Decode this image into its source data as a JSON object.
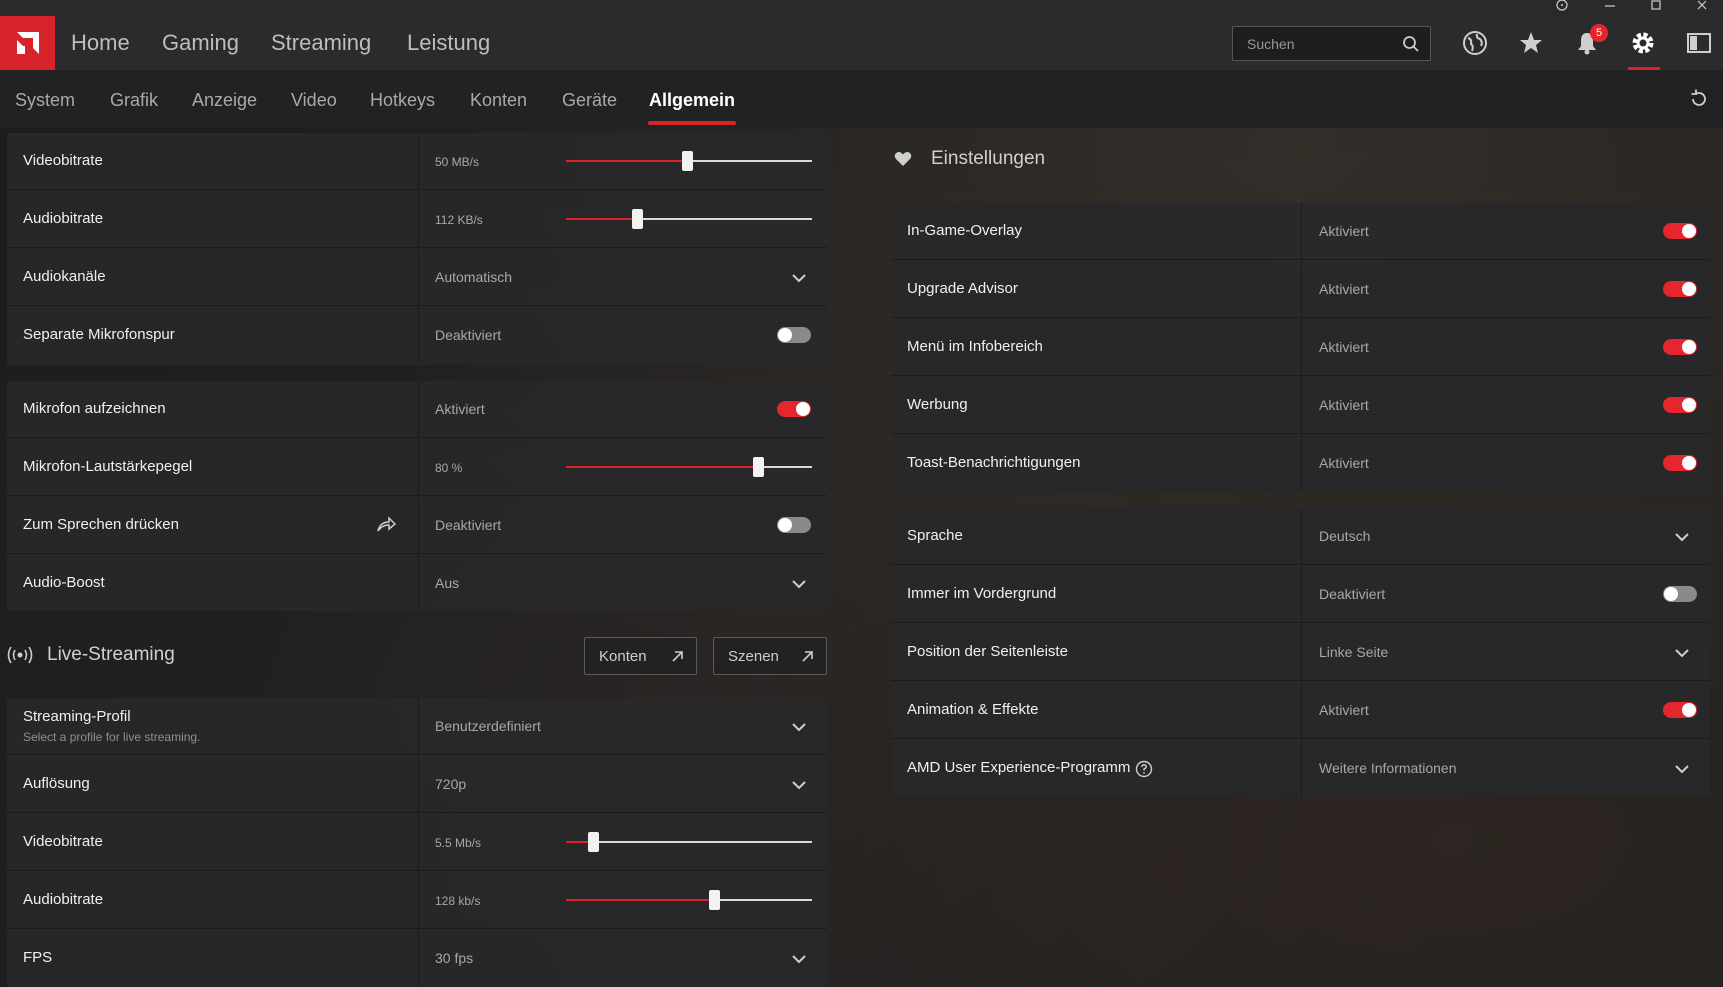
{
  "topnav": {
    "items": [
      "Home",
      "Gaming",
      "Streaming",
      "Leistung"
    ],
    "search_placeholder": "Suchen",
    "notification_count": "5"
  },
  "subnav": {
    "tabs": [
      "System",
      "Grafik",
      "Anzeige",
      "Video",
      "Hotkeys",
      "Konten",
      "Geräte",
      "Allgemein"
    ],
    "active": "Allgemein"
  },
  "recording": {
    "rows": [
      {
        "label": "Videobitrate",
        "value": "50 MB/s",
        "type": "slider",
        "level": 0.49
      },
      {
        "label": "Audiobitrate",
        "value": "112 KB/s",
        "type": "slider",
        "level": 0.29
      },
      {
        "label": "Audiokanäle",
        "value": "Automatisch",
        "type": "dropdown"
      },
      {
        "label": "Separate Mikrofonspur",
        "value": "Deaktiviert",
        "type": "toggle",
        "on": false
      }
    ]
  },
  "mic": {
    "rows": [
      {
        "label": "Mikrofon aufzeichnen",
        "value": "Aktiviert",
        "type": "toggle",
        "on": true
      },
      {
        "label": "Mikrofon-Lautstärkepegel",
        "value": "80 %",
        "type": "slider",
        "level": 0.8
      },
      {
        "label": "Zum Sprechen drücken",
        "value": "Deaktiviert",
        "type": "toggle",
        "on": false
      },
      {
        "label": "Audio-Boost",
        "value": "Aus",
        "type": "dropdown"
      }
    ]
  },
  "live_streaming": {
    "title": "Live-Streaming",
    "btn_accounts": "Konten",
    "btn_scenes": "Szenen",
    "rows": [
      {
        "label": "Streaming-Profil",
        "sublabel": "Select a profile for live streaming.",
        "value": "Benutzerdefiniert",
        "type": "dropdown"
      },
      {
        "label": "Auflösung",
        "value": "720p",
        "type": "dropdown"
      },
      {
        "label": "Videobitrate",
        "value": "5.5 Mb/s",
        "type": "slider",
        "level": 0.11
      },
      {
        "label": "Audiobitrate",
        "value": "128 kb/s",
        "type": "slider",
        "level": 0.6
      },
      {
        "label": "FPS",
        "value": "30 fps",
        "type": "dropdown"
      }
    ]
  },
  "settings": {
    "title": "Einstellungen",
    "group1": [
      {
        "label": "In-Game-Overlay",
        "value": "Aktiviert",
        "on": true
      },
      {
        "label": "Upgrade Advisor",
        "value": "Aktiviert",
        "on": true
      },
      {
        "label": "Menü im Infobereich",
        "value": "Aktiviert",
        "on": true
      },
      {
        "label": "Werbung",
        "value": "Aktiviert",
        "on": true
      },
      {
        "label": "Toast-Benachrichtigungen",
        "value": "Aktiviert",
        "on": true
      }
    ],
    "group2": [
      {
        "label": "Sprache",
        "value": "Deutsch",
        "type": "dropdown"
      },
      {
        "label": "Immer im Vordergrund",
        "value": "Deaktiviert",
        "type": "toggle",
        "on": false
      },
      {
        "label": "Position der Seitenleiste",
        "value": "Linke Seite",
        "type": "dropdown"
      },
      {
        "label": "Animation & Effekte",
        "value": "Aktiviert",
        "type": "toggle",
        "on": true
      },
      {
        "label": "AMD User Experience-Programm",
        "value": "Weitere Informationen",
        "type": "dropdown"
      }
    ]
  },
  "colors": {
    "accent": "#d8232a",
    "panel": "#28282a",
    "text": "#f0f0f0",
    "muted": "#a8a8a8"
  }
}
